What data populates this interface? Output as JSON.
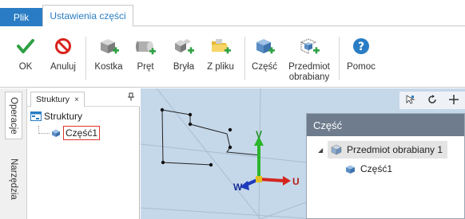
{
  "tabs": {
    "file": "Plik",
    "part_settings": "Ustawienia części"
  },
  "ribbon": {
    "buttons": [
      {
        "id": "ok",
        "label": "OK",
        "icon": "check-icon"
      },
      {
        "id": "cancel",
        "label": "Anuluj",
        "icon": "cancel-icon"
      },
      {
        "id": "cube",
        "label": "Kostka",
        "icon": "cube-add-icon"
      },
      {
        "id": "bar",
        "label": "Pręt",
        "icon": "cylinder-add-icon"
      },
      {
        "id": "solid",
        "label": "Bryła",
        "icon": "solid-add-icon"
      },
      {
        "id": "from_file",
        "label": "Z pliku",
        "icon": "folder-add-icon"
      },
      {
        "id": "part",
        "label": "Część",
        "icon": "part-add-icon"
      },
      {
        "id": "workpiece",
        "label": "Przedmiot\nobrabiany",
        "icon": "workpiece-add-icon"
      },
      {
        "id": "help",
        "label": "Pomoc",
        "icon": "help-icon"
      }
    ],
    "workpiece_line1": "Przedmiot",
    "workpiece_line2": "obrabiany"
  },
  "side_tabs": {
    "operations": "Operacje",
    "tools": "Narzędzia"
  },
  "structure_panel": {
    "tab_label": "Struktury",
    "tab_close": "×",
    "pin": "ᵽ",
    "root": "Struktury",
    "child": "Część1"
  },
  "viewport": {
    "axis_v": "V",
    "axis_u": "U",
    "axis_w": "W",
    "colors": {
      "background": "#c5d8ea",
      "v_axis": "#2bb52b",
      "u_axis": "#d4261f",
      "w_axis": "#1f3bbd"
    }
  },
  "part_dialog": {
    "title": "Część",
    "workpiece_item": "Przedmiot obrabiany 1",
    "part_item": "Część1"
  },
  "colors": {
    "accent": "#2a7dc4",
    "dialog_title_bg": "#6e7c8d"
  }
}
